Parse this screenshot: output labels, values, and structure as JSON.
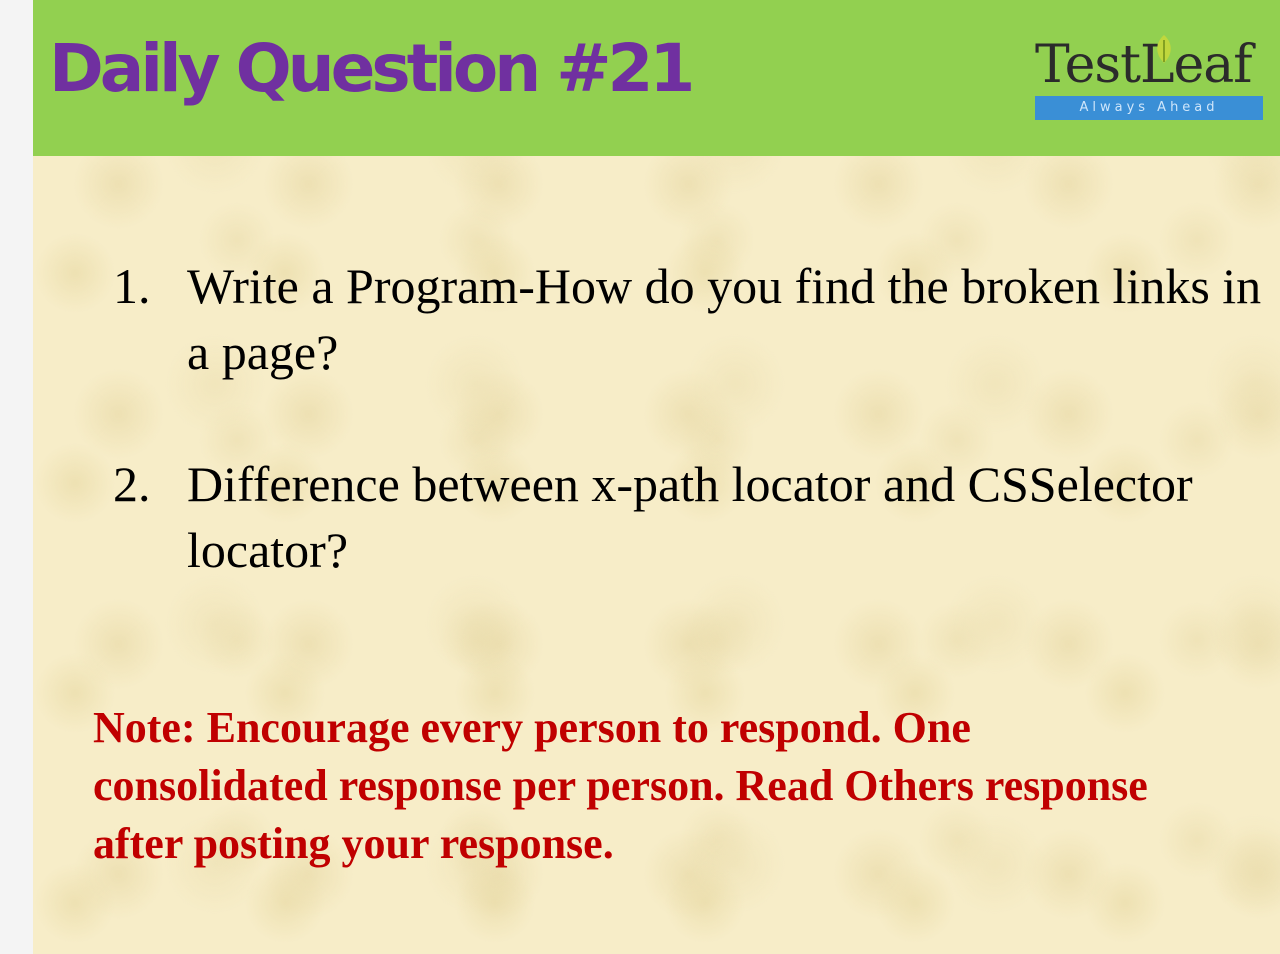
{
  "header": {
    "title": "Daily Question #21",
    "background_color": "#92d050",
    "title_color": "#7030a0"
  },
  "logo": {
    "name": "TestLeaf",
    "tagline": "Always Ahead"
  },
  "questions": [
    {
      "number": "1.",
      "text": "Write a Program-How do you find the broken links in a page?"
    },
    {
      "number": "2.",
      "text": "Difference between x-path locator and CSSelector locator?"
    }
  ],
  "note": {
    "text": "Note: Encourage every person to respond. One consolidated response per person. Read Others response after posting your response.",
    "color": "#c00000"
  }
}
